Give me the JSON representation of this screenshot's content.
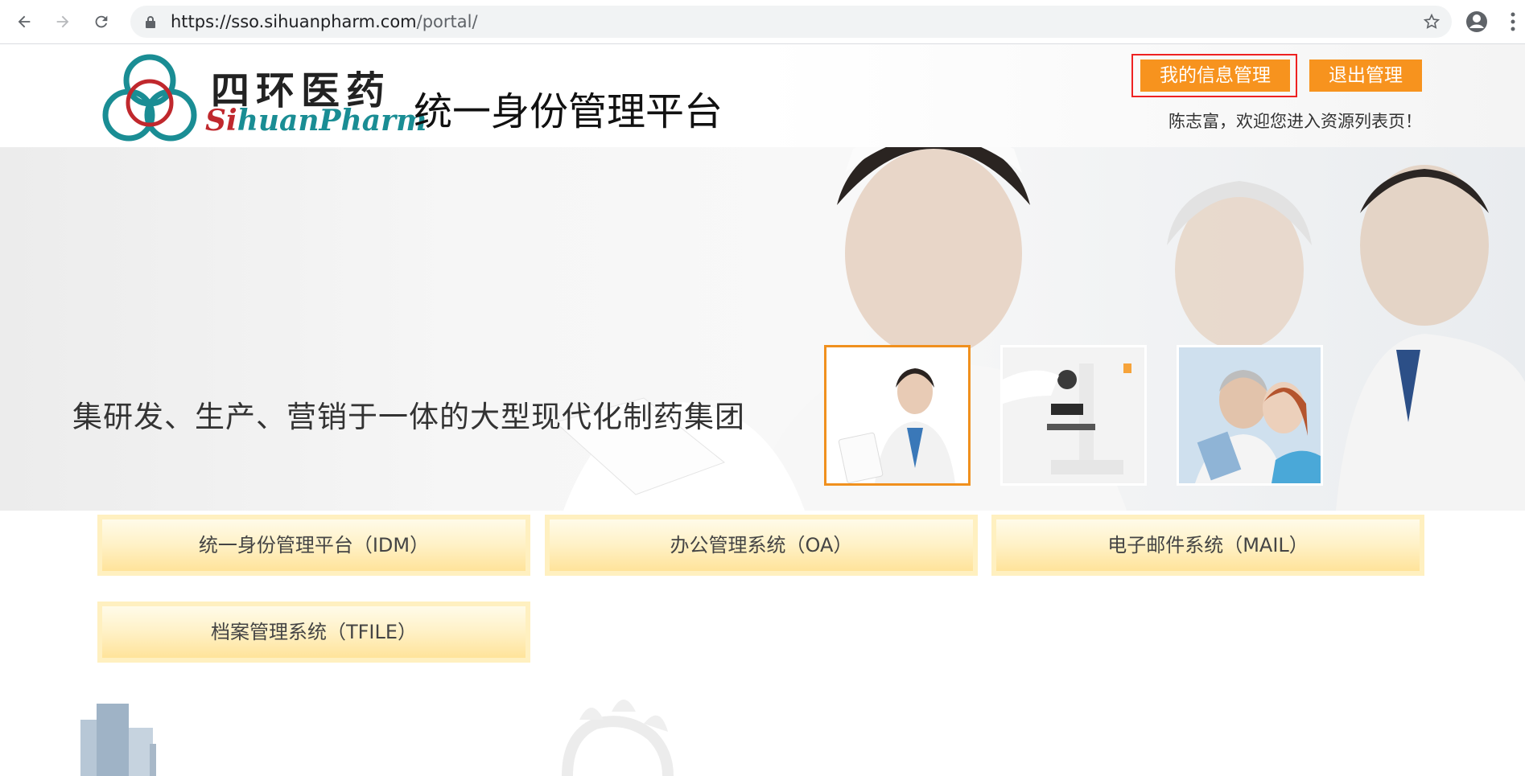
{
  "browser": {
    "url_host": "https://sso.sihuanpharm.com",
    "url_path": "/portal/",
    "icons": [
      "back-icon",
      "forward-icon",
      "reload-icon",
      "lock-icon",
      "star-icon",
      "profile-icon",
      "menu-icon"
    ]
  },
  "header": {
    "logo_cn": "四环医药",
    "logo_en_s": "Si",
    "logo_en_rest": "huanPharm",
    "title": "统一身份管理平台",
    "my_info_label": "我的信息管理",
    "logout_label": "退出管理",
    "welcome": "陈志富，欢迎您进入资源列表页！"
  },
  "banner": {
    "slogan": "集研发、生产、营销于一体的大型现代化制药集团",
    "thumbnails": [
      "doctor-thumbnail",
      "microscope-thumbnail",
      "researchers-thumbnail"
    ],
    "active_index": 0
  },
  "systems": [
    {
      "label": "统一身份管理平台（IDM）"
    },
    {
      "label": "办公管理系统（OA）"
    },
    {
      "label": "电子邮件系统（MAIL）"
    },
    {
      "label": "档案管理系统（TFILE）"
    }
  ],
  "colors": {
    "accent": "#f7931e",
    "highlight_border": "#ee2222",
    "logo_teal": "#1a8d94",
    "logo_red": "#c0282d",
    "system_button_border": "#fff0c0"
  }
}
